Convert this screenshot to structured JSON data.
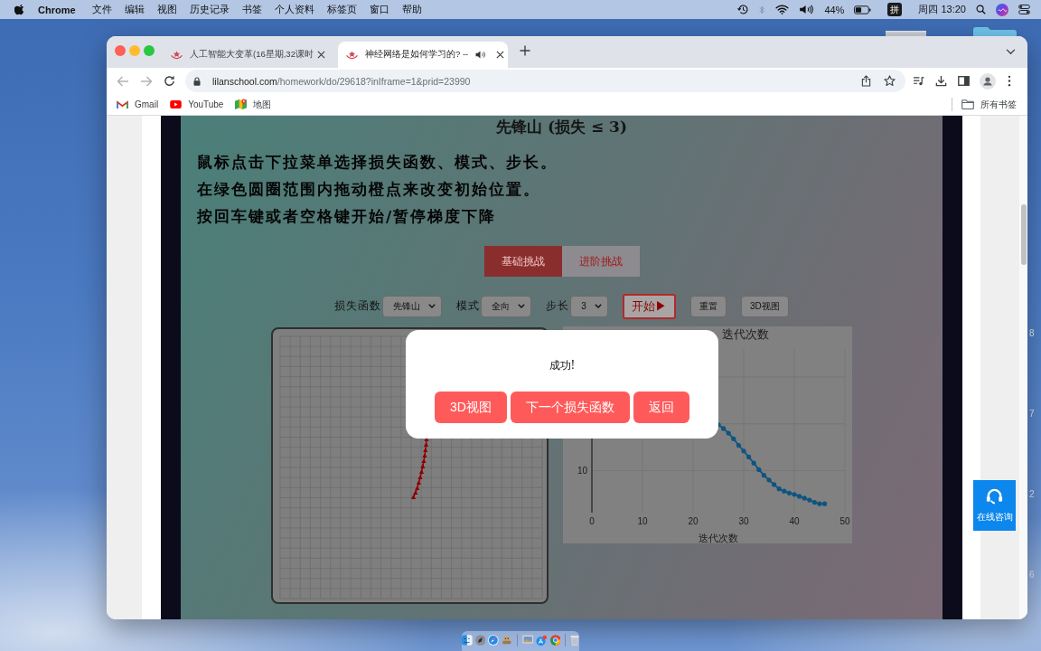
{
  "menu_bar": {
    "app": "Chrome",
    "items": [
      "文件",
      "编辑",
      "视图",
      "历史记录",
      "书签",
      "个人资料",
      "标签页",
      "窗口",
      "帮助"
    ],
    "battery": "44%",
    "input_method": "拼",
    "clock": "周四 13:20"
  },
  "desktop": {
    "edge_labels": [
      "8",
      "7",
      "2",
      "6"
    ]
  },
  "browser": {
    "tabs": [
      {
        "title": "人工智能大变革(16星期,32课时",
        "selected": false,
        "audio": false
      },
      {
        "title": "神经网络是如何学习的? --",
        "selected": true,
        "audio": true
      }
    ],
    "url": {
      "host": "lilanschool.com",
      "path": "/homework/do/29618?inIframe=1&prid=23990"
    },
    "bookmarks": [
      {
        "kind": "gmail",
        "label": "Gmail"
      },
      {
        "kind": "youtube",
        "label": "YouTube"
      },
      {
        "kind": "maps",
        "label": "地图"
      }
    ],
    "all_bookmarks": "所有书签"
  },
  "page": {
    "title": "先锋山 (损失 ≤ 3)",
    "instructions": [
      "鼠标点击下拉菜单选择损失函数、模式、步长。",
      "在绿色圆圈范围内拖动橙点来改变初始位置。",
      "按回车键或者空格键开始/暂停梯度下降"
    ],
    "challenge_tabs": [
      {
        "label": "基础挑战",
        "selected": true
      },
      {
        "label": "进阶挑战",
        "selected": false
      }
    ],
    "controls": [
      {
        "kind": "select",
        "label": "损失函数",
        "value": "先锋山"
      },
      {
        "kind": "select",
        "label": "模式",
        "value": "全向"
      },
      {
        "kind": "select",
        "label": "步长",
        "value": "3"
      },
      {
        "kind": "primary",
        "label": "开始▶"
      },
      {
        "kind": "button",
        "label": "重置"
      },
      {
        "kind": "button",
        "label": "3D视图"
      }
    ],
    "loss_chart": {
      "title": "迭代次数",
      "x_tick_labels": [
        "0",
        "10",
        "20",
        "30",
        "40",
        "50"
      ],
      "y_tick_labels": [
        "10"
      ],
      "xlabel": "迭代次数"
    },
    "dialog": {
      "message": "成功!",
      "buttons": [
        "3D视图",
        "下一个损失函数",
        "返回"
      ]
    },
    "support": {
      "label": "在线咨询"
    }
  }
}
